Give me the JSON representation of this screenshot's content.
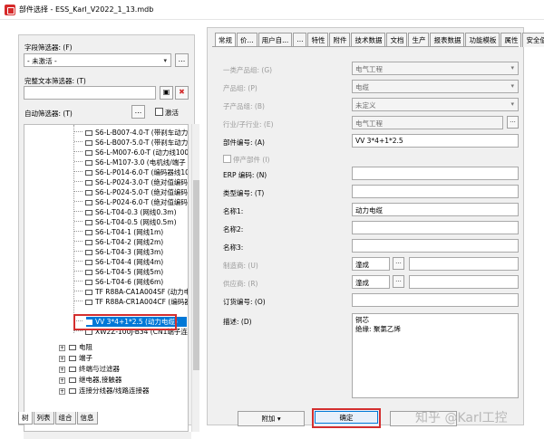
{
  "window": {
    "title": "部件选择 - ESS_Karl_V2022_1_13.mdb"
  },
  "left_panel": {
    "field_filter_label": "字段筛选器: (F)",
    "field_filter_value": "- 未激活 -",
    "fulltext_filter_label": "完整文本筛选器: (T)",
    "fulltext_filter_value": "",
    "auto_filter_label": "自动筛选器: (T)",
    "activate_label": "激活",
    "more_btn": "...",
    "tree_items": [
      {
        "label": "S6-L-B007-4.0-T (带刹车动力"
      },
      {
        "label": "S6-L-B007-5.0-T (带刹车动力"
      },
      {
        "label": "S6-L-M007-6.0-T (动力线100"
      },
      {
        "label": "S6-L-M107-3.0 (电机线/端子"
      },
      {
        "label": "S6-L-P014-6.0-T (编码器线10"
      },
      {
        "label": "S6-L-P024-3.0-T (绝对值编码"
      },
      {
        "label": "S6-L-P024-5.0-T (绝对值编码"
      },
      {
        "label": "S6-L-P024-6.0-T (绝对值编码"
      },
      {
        "label": "S6-L-T04-0.3 (网线0.3m)"
      },
      {
        "label": "S6-L-T04-0.5 (网线0.5m)"
      },
      {
        "label": "S6-L-T04-1 (网线1m)"
      },
      {
        "label": "S6-L-T04-2 (网线2m)"
      },
      {
        "label": "S6-L-T04-3 (网线3m)"
      },
      {
        "label": "S6-L-T04-4 (网线4m)"
      },
      {
        "label": "S6-L-T04-5 (网线5m)"
      },
      {
        "label": "S6-L-T04-6 (网线6m)"
      },
      {
        "label": "TF R88A-CA1A004SF (动力电"
      },
      {
        "label": "TF R88A-CR1A004CF (编码器"
      },
      {
        "label": "VV 3*4+1*2.5 (动力电缆)"
      },
      {
        "label": "XW2Z-100J-B34 (CN1端子连"
      }
    ],
    "tree_groups": [
      {
        "label": "电阻"
      },
      {
        "label": "端子"
      },
      {
        "label": "终端与过滤器"
      },
      {
        "label": "继电器,接触器"
      },
      {
        "label": "连接分线器/线路连接器"
      }
    ],
    "bottom_tabs": [
      "树",
      "列表",
      "组合",
      "信息"
    ]
  },
  "right_panel": {
    "tabs": [
      "常规",
      "价...",
      "用户自...",
      "...",
      "特性",
      "附件",
      "技术数据",
      "文档",
      "生产",
      "报表数据",
      "功能模板",
      "属性",
      "安全值"
    ],
    "fields": {
      "product_group_label": "一类产品组: (G)",
      "product_group_value": "电气工程",
      "product_label": "产品组: (P)",
      "product_value": "电缆",
      "subproduct_label": "子产品组: (B)",
      "subproduct_value": "未定义",
      "industry_label": "行业/子行业: (E)",
      "industry_value": "电气工程",
      "part_number_label": "部件编号: (A)",
      "part_number_value": "VV 3*4+1*2.5",
      "discontinued_label": "停产部件 (I)",
      "erp_label": "ERP 编码: (N)",
      "erp_value": "",
      "type_label": "类型编号: (T)",
      "type_value": "",
      "name1_label": "名称1:",
      "name1_value": "动力电缆",
      "name2_label": "名称2:",
      "name2_value": "",
      "name3_label": "名称3:",
      "name3_value": "",
      "manufacturer_label": "制造商: (U)",
      "manufacturer_value": "潼成",
      "supplier_label": "供应商: (R)",
      "supplier_value": "潼成",
      "order_label": "订货编号: (O)",
      "order_value": "",
      "desc_label": "描述: (D)",
      "desc_line1": "铜芯",
      "desc_line2": "绝缘: 聚氯乙烯"
    },
    "buttons": {
      "add": "附加",
      "ok": "确定",
      "dots": "..."
    }
  },
  "watermark": "知乎 @Karl工控"
}
